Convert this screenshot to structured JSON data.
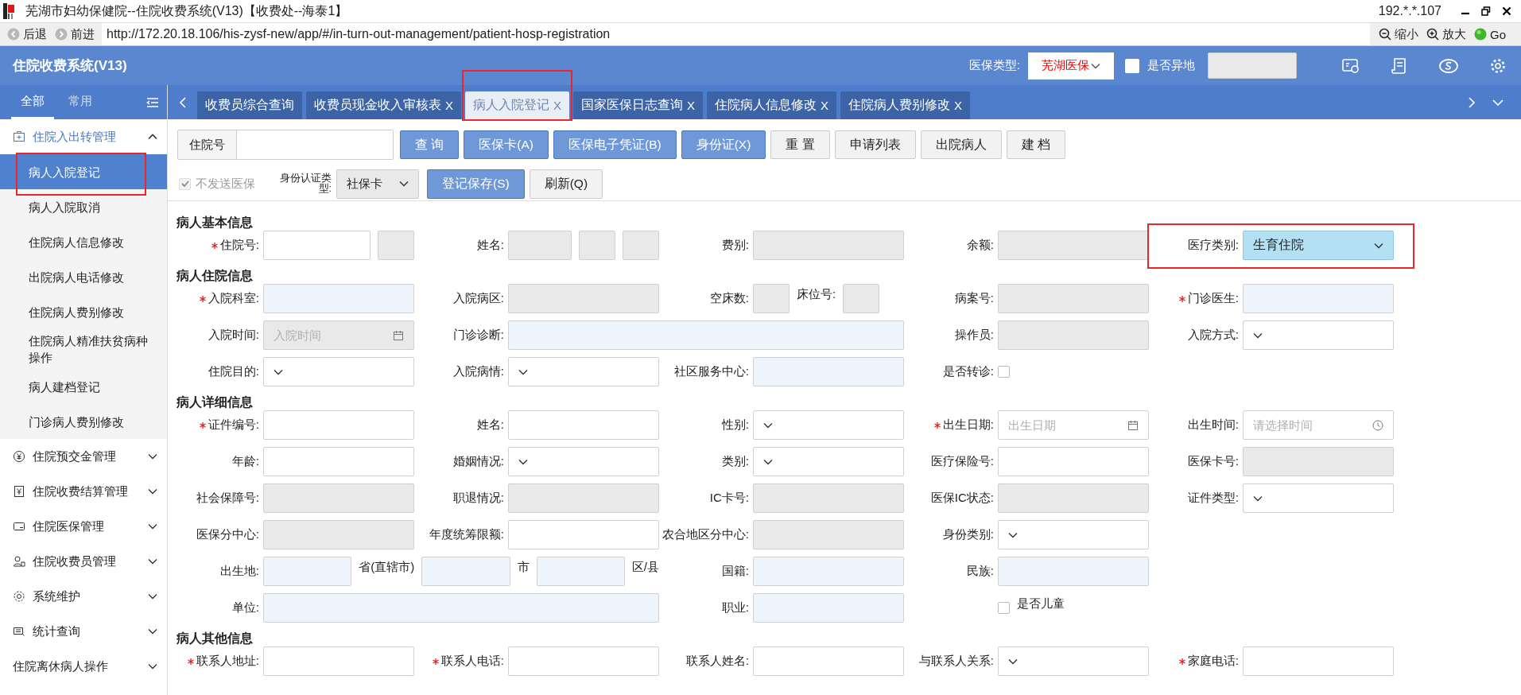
{
  "window": {
    "title": "芜湖市妇幼保健院--住院收费系统(V13)【收费处--海泰1】",
    "ip": "192.*.*.107"
  },
  "browser": {
    "back": "后退",
    "forward": "前进",
    "url": "http://172.20.18.106/his-zysf-new/app/#/in-turn-out-management/patient-hosp-registration",
    "zoom_out": "缩小",
    "zoom_in": "放大",
    "go": "Go"
  },
  "header": {
    "title": "住院收费系统(V13)",
    "insurance_label": "医保类型:",
    "insurance_value": "芜湖医保",
    "remote_checked": false,
    "remote_label": "是否异地"
  },
  "sidebar": {
    "tabs": [
      {
        "label": "全部",
        "selected": true
      },
      {
        "label": "常用",
        "selected": false
      }
    ],
    "groups": [
      {
        "label": "住院入出转管理",
        "expanded": true,
        "items": [
          {
            "label": "病人入院登记",
            "selected": true,
            "highlighted": true
          },
          {
            "label": "病人入院取消",
            "selected": false,
            "highlighted": false
          },
          {
            "label": "住院病人信息修改",
            "selected": false,
            "highlighted": false
          },
          {
            "label": "出院病人电话修改",
            "selected": false,
            "highlighted": false
          },
          {
            "label": "住院病人费别修改",
            "selected": false,
            "highlighted": false
          },
          {
            "label": "住院病人精准扶贫病种操作",
            "selected": false,
            "highlighted": false
          },
          {
            "label": "病人建档登记",
            "selected": false,
            "highlighted": false
          },
          {
            "label": "门诊病人费别修改",
            "selected": false,
            "highlighted": false
          }
        ]
      },
      {
        "label": "住院预交金管理",
        "expanded": false
      },
      {
        "label": "住院收费结算管理",
        "expanded": false
      },
      {
        "label": "住院医保管理",
        "expanded": false
      },
      {
        "label": "住院收费员管理",
        "expanded": false
      },
      {
        "label": "系统维护",
        "expanded": false
      },
      {
        "label": "统计查询",
        "expanded": false
      },
      {
        "label": "住院离休病人操作",
        "expanded": false
      }
    ]
  },
  "tabs": [
    {
      "label": "收费员综合查询",
      "selected": false,
      "highlighted": false
    },
    {
      "label": "收费员现金收入审核表",
      "close": "X",
      "selected": false,
      "highlighted": false
    },
    {
      "label": "病人入院登记",
      "close": "X",
      "selected": true,
      "highlighted": true
    },
    {
      "label": "国家医保日志查询",
      "close": "X",
      "selected": false,
      "highlighted": false
    },
    {
      "label": "住院病人信息修改",
      "close": "X",
      "selected": false,
      "highlighted": false
    },
    {
      "label": "住院病人费别修改",
      "close": "X",
      "selected": false,
      "highlighted": false
    }
  ],
  "toolbar": {
    "search_label": "住院号",
    "buttons": [
      {
        "label": "查 询",
        "kind": "primary"
      },
      {
        "label": "医保卡(A)",
        "kind": "primary"
      },
      {
        "label": "医保电子凭证(B)",
        "kind": "primary"
      },
      {
        "label": "身份证(X)",
        "kind": "primary"
      },
      {
        "label": "重 置",
        "kind": "default"
      },
      {
        "label": "申请列表",
        "kind": "default"
      },
      {
        "label": "出院病人",
        "kind": "default"
      },
      {
        "label": "建 档",
        "kind": "default"
      }
    ],
    "no_send": {
      "label": "不发送医保",
      "checked": true,
      "disabled": true
    },
    "id_type_label": "身份认证类型:",
    "id_type_value": "社保卡",
    "buttons2": [
      {
        "label": "登记保存(S)",
        "kind": "primary"
      },
      {
        "label": "刷新(Q)",
        "kind": "default"
      }
    ]
  },
  "sections": [
    {
      "title": "病人基本信息",
      "rows": [
        [
          {
            "label": "住院号:",
            "required": true,
            "parts": [
              {
                "kind": "input"
              },
              {
                "kind": "short"
              }
            ]
          },
          {
            "label": "姓名:",
            "required": false,
            "parts": [
              {
                "kind": "readonly"
              },
              {
                "kind": "short"
              },
              {
                "kind": "short"
              }
            ]
          },
          {
            "label": "费别:",
            "required": false,
            "parts": [
              {
                "kind": "readonly"
              }
            ]
          },
          {
            "label": "余额:",
            "required": false,
            "parts": [
              {
                "kind": "readonly"
              }
            ]
          },
          {
            "label": "医疗类别:",
            "required": false,
            "highlighted": true,
            "parts": [
              {
                "kind": "select",
                "focused": true,
                "value": "生育住院"
              }
            ]
          }
        ]
      ]
    },
    {
      "title": "病人住院信息",
      "rows": [
        [
          {
            "label": "入院科室:",
            "required": true,
            "parts": [
              {
                "kind": "lookup"
              }
            ]
          },
          {
            "label": "入院病区:",
            "required": false,
            "parts": [
              {
                "kind": "readonly"
              }
            ]
          },
          {
            "label": "空床数:",
            "required": false,
            "parts": [
              {
                "kind": "short"
              },
              {
                "kind": "text",
                "text": "床位号:"
              },
              {
                "kind": "short"
              }
            ]
          },
          {
            "label": "病案号:",
            "required": false,
            "parts": [
              {
                "kind": "readonly"
              }
            ]
          },
          {
            "label": "门诊医生:",
            "required": true,
            "parts": [
              {
                "kind": "lookup"
              }
            ]
          }
        ],
        [
          {
            "label": "入院时间:",
            "required": false,
            "parts": [
              {
                "kind": "date",
                "disabled": true,
                "placeholder": "入院时间"
              }
            ]
          },
          {
            "label": "门诊诊断:",
            "required": false,
            "parts": [
              {
                "kind": "lookup"
              }
            ]
          },
          "",
          {
            "label": "操作员:",
            "required": false,
            "parts": [
              {
                "kind": "readonly"
              }
            ]
          },
          {
            "label": "入院方式:",
            "required": false,
            "parts": [
              {
                "kind": "select",
                "focused": false
              }
            ]
          }
        ],
        [
          {
            "label": "住院目的:",
            "required": false,
            "parts": [
              {
                "kind": "select",
                "focused": false
              }
            ]
          },
          {
            "label": "入院病情:",
            "required": false,
            "parts": [
              {
                "kind": "select",
                "focused": false
              }
            ]
          },
          {
            "label": "社区服务中心:",
            "required": false,
            "parts": [
              {
                "kind": "lookup"
              }
            ]
          },
          {
            "label": "是否转诊:",
            "required": false,
            "parts": [
              {
                "kind": "checkbox",
                "checked": false
              }
            ]
          }
        ]
      ]
    },
    {
      "title": "病人详细信息",
      "rows": [
        [
          {
            "label": "证件编号:",
            "required": true,
            "parts": [
              {
                "kind": "input"
              }
            ]
          },
          {
            "label": "姓名:",
            "required": false,
            "parts": [
              {
                "kind": "input"
              }
            ]
          },
          {
            "label": "性别:",
            "required": false,
            "parts": [
              {
                "kind": "select",
                "focused": false
              }
            ]
          },
          {
            "label": "出生日期:",
            "required": true,
            "parts": [
              {
                "kind": "date",
                "disabled": false,
                "placeholder": "出生日期"
              }
            ]
          },
          {
            "label": "出生时间:",
            "required": false,
            "parts": [
              {
                "kind": "time",
                "disabled": false,
                "placeholder": "请选择时间"
              }
            ]
          }
        ],
        [
          {
            "label": "年龄:",
            "required": false,
            "parts": [
              {
                "kind": "input"
              }
            ]
          },
          {
            "label": "婚姻情况:",
            "required": false,
            "parts": [
              {
                "kind": "select",
                "focused": false
              }
            ]
          },
          {
            "label": "类别:",
            "required": false,
            "parts": [
              {
                "kind": "select",
                "focused": false
              }
            ]
          },
          {
            "label": "医疗保险号:",
            "required": false,
            "parts": [
              {
                "kind": "input"
              }
            ]
          },
          {
            "label": "医保卡号:",
            "required": false,
            "parts": [
              {
                "kind": "readonly"
              }
            ]
          }
        ],
        [
          {
            "label": "社会保障号:",
            "required": false,
            "parts": [
              {
                "kind": "readonly"
              }
            ]
          },
          {
            "label": "职退情况:",
            "required": false,
            "parts": [
              {
                "kind": "readonly"
              }
            ]
          },
          {
            "label": "IC卡号:",
            "required": false,
            "parts": [
              {
                "kind": "readonly"
              }
            ]
          },
          {
            "label": "医保IC状态:",
            "required": false,
            "parts": [
              {
                "kind": "readonly"
              }
            ]
          },
          {
            "label": "证件类型:",
            "required": false,
            "parts": [
              {
                "kind": "select",
                "focused": false
              }
            ]
          }
        ],
        [
          {
            "label": "医保分中心:",
            "required": false,
            "parts": [
              {
                "kind": "readonly"
              }
            ]
          },
          {
            "label": "年度统筹限额:",
            "required": false,
            "parts": [
              {
                "kind": "input"
              }
            ]
          },
          {
            "label": "农合地区分中心:",
            "required": false,
            "parts": [
              {
                "kind": "readonly"
              }
            ]
          },
          {
            "label": "身份类别:",
            "required": false,
            "parts": [
              {
                "kind": "select",
                "focused": false
              }
            ]
          }
        ],
        [
          {
            "label": "出生地:",
            "required": false,
            "parts": [
              {
                "kind": "lookup"
              },
              {
                "kind": "text",
                "text": "省(直辖市)"
              },
              {
                "kind": "lookup"
              },
              {
                "kind": "text",
                "text": "市"
              },
              {
                "kind": "lookup"
              },
              {
                "kind": "text",
                "text": "区/县"
              }
            ]
          },
          "",
          {
            "label": "国籍:",
            "required": false,
            "parts": [
              {
                "kind": "lookup"
              }
            ]
          },
          {
            "label": "民族:",
            "required": false,
            "parts": [
              {
                "kind": "lookup"
              }
            ]
          }
        ],
        [
          {
            "label": "单位:",
            "required": false,
            "parts": [
              {
                "kind": "lookup"
              }
            ]
          },
          "",
          {
            "label": "职业:",
            "required": false,
            "parts": [
              {
                "kind": "lookup"
              }
            ]
          },
          {
            "parts": [
              {
                "kind": "checkbox",
                "checked": false
              },
              {
                "kind": "text",
                "text": "是否儿童"
              }
            ]
          }
        ]
      ]
    },
    {
      "title": "病人其他信息",
      "rows": [
        [
          {
            "label": "联系人地址:",
            "required": true,
            "parts": [
              {
                "kind": "input"
              }
            ]
          },
          {
            "label": "联系人电话:",
            "required": true,
            "parts": [
              {
                "kind": "input"
              }
            ]
          },
          {
            "label": "联系人姓名:",
            "required": false,
            "parts": [
              {
                "kind": "input"
              }
            ]
          },
          {
            "label": "与联系人关系:",
            "required": false,
            "parts": [
              {
                "kind": "select",
                "focused": false
              }
            ]
          },
          {
            "label": "家庭电话:",
            "required": true,
            "parts": [
              {
                "kind": "input"
              }
            ]
          }
        ]
      ]
    }
  ]
}
